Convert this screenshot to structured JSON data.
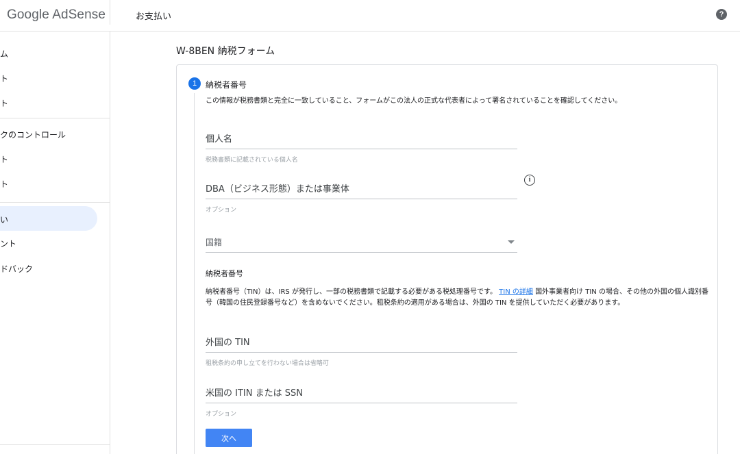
{
  "header": {
    "logo": "Google AdSense",
    "page_title": "お支払い",
    "help_icon": "?"
  },
  "sidebar": {
    "items": [
      {
        "label": "ム"
      },
      {
        "label": "ト"
      },
      {
        "label": "ト"
      },
      {
        "label": "クのコントロール"
      },
      {
        "label": "ト"
      },
      {
        "label": "ト"
      },
      {
        "label": "い",
        "active": true
      },
      {
        "label": "ント"
      },
      {
        "label": "ドバック"
      }
    ]
  },
  "form": {
    "title": "W-8BEN 納税フォーム",
    "step": {
      "number": "1",
      "title": "納税者番号",
      "description": "この情報が税務書類と完全に一致していること、フォームがこの法人の正式な代表者によって署名されていることを確認してください。"
    },
    "fields": {
      "individual_name": {
        "label": "個人名",
        "hint": "税務書類に記載されている個人名"
      },
      "dba": {
        "label": "DBA（ビジネス形態）または事業体",
        "hint": "オプション",
        "info_icon": "i"
      },
      "nationality": {
        "label": "国籍"
      },
      "foreign_tin": {
        "label": "外国の TIN",
        "hint": "租税条約の申し立てを行わない場合は省略可"
      },
      "us_itin": {
        "label": "米国の ITIN または SSN",
        "hint": "オプション"
      }
    },
    "tin_section": {
      "heading": "納税者番号",
      "text_before": "納税者番号（TIN）は、IRS が発行し、一部の税務書類で記載する必要がある税処理番号です。",
      "link": "TIN の詳細",
      "text_after": "国外事業者向け TIN の場合、その他の外国の個人識別番号（韓国の住民登録番号など）を含めないでください。租税条約の適用がある場合は、外国の TIN を提供していただく必要があります。"
    },
    "next_button": "次へ"
  },
  "colors": {
    "accent": "#1a73e8",
    "button": "#4285f4",
    "active_nav": "#e8f0fe"
  }
}
